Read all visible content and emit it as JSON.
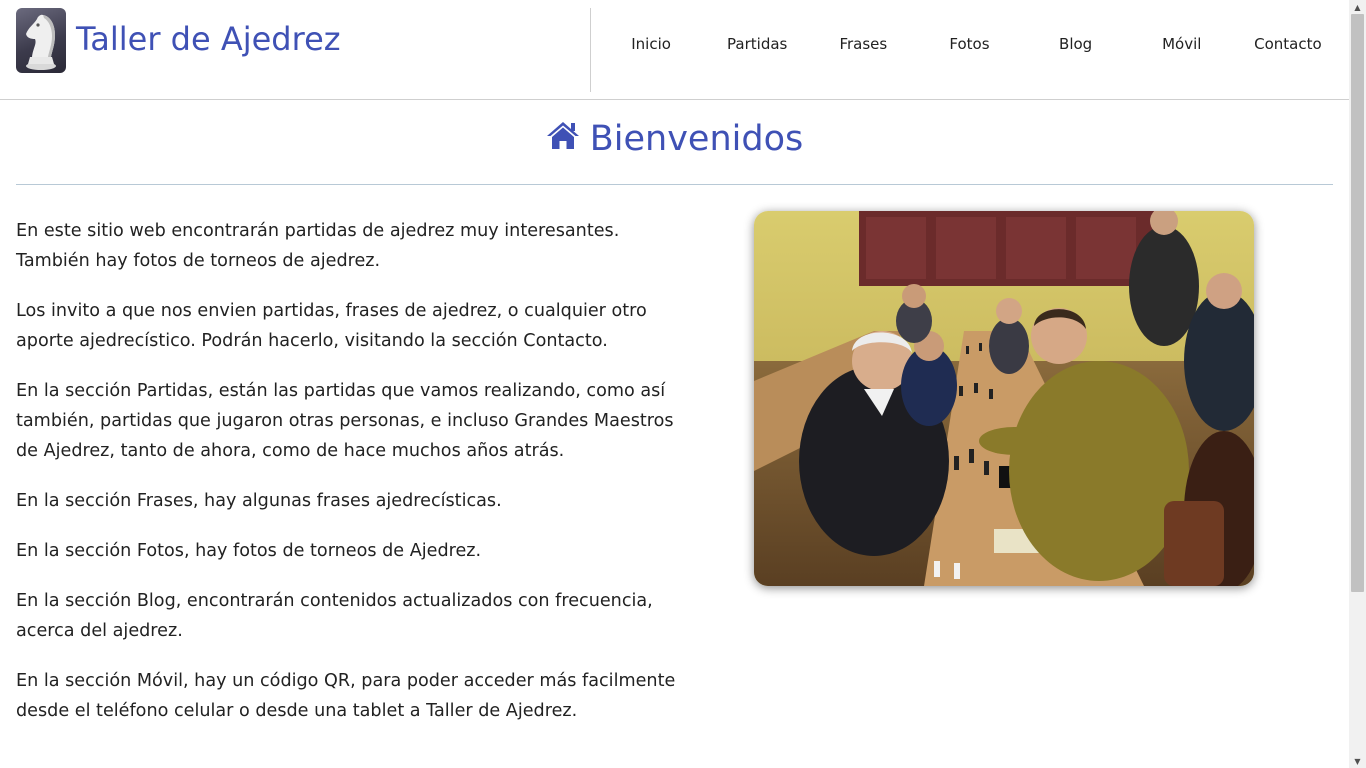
{
  "header": {
    "site_title": "Taller de Ajedrez",
    "logo_icon": "chess-knight-icon"
  },
  "nav": {
    "items": [
      {
        "label": "Inicio"
      },
      {
        "label": "Partidas"
      },
      {
        "label": "Frases"
      },
      {
        "label": "Fotos"
      },
      {
        "label": "Blog"
      },
      {
        "label": "Móvil"
      },
      {
        "label": "Contacto"
      }
    ]
  },
  "main": {
    "heading_icon": "home-icon",
    "heading": "Bienvenidos",
    "paragraphs": [
      "En este sitio web encontrarán partidas de ajedrez muy interesantes. También hay fotos de torneos de ajedrez.",
      "Los invito a que nos envien partidas, frases de ajedrez, o cualquier otro aporte ajedrecístico. Podrán hacerlo, visitando la sección Contacto.",
      "En la sección Partidas, están las partidas que vamos realizando, como así también, partidas que jugaron otras personas, e incluso Grandes Maestros de Ajedrez, tanto de ahora, como de hace muchos años atrás.",
      "En la sección Frases, hay algunas frases ajedrecísticas.",
      "En la sección Fotos, hay fotos de torneos de Ajedrez.",
      "En la sección Blog, encontrarán contenidos actualizados con frecuencia, acerca del ajedrez.",
      "En la sección Móvil, hay un código QR, para poder acceder más facilmente desde el teléfono celular o desde una tablet a Taller de Ajedrez."
    ]
  },
  "colors": {
    "accent": "#3f51b5",
    "rule": "#b8c9d6"
  }
}
